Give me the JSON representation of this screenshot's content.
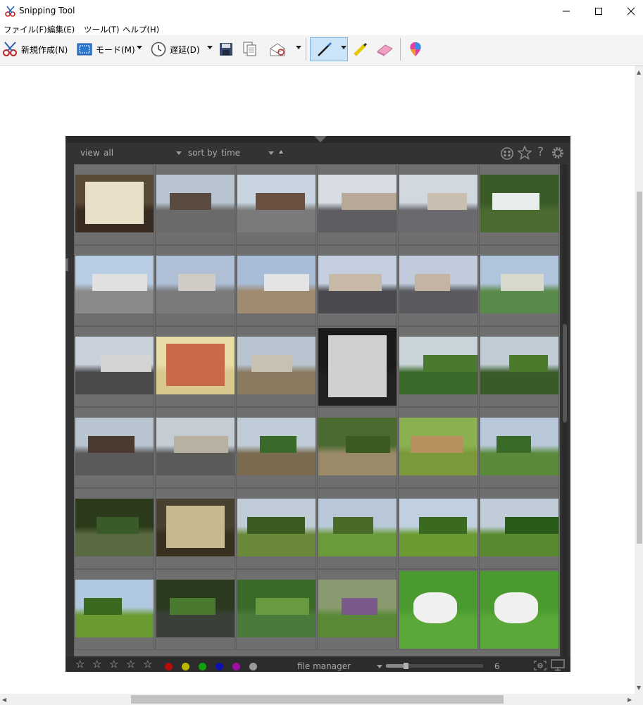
{
  "window": {
    "title": "Snipping Tool"
  },
  "menu": [
    "ファイル(F)",
    "編集(E)",
    "ツール(T)",
    "ヘルプ(H)"
  ],
  "toolbar": {
    "new_label": "新規作成(N)",
    "mode_label": "モード(M)",
    "delay_label": "遅延(D)"
  },
  "darktable": {
    "view_label": "view",
    "view_value": "all",
    "sort_label": "sort by",
    "sort_value": "time",
    "module_label": "file manager",
    "zoom_value": "6"
  },
  "color_labels": [
    "#b80c0c",
    "#bbb800",
    "#10a010",
    "#1010b0",
    "#a010a0",
    "#9a9a9a"
  ],
  "icons": [
    "scissors-icon",
    "pen-icon",
    "highlighter-icon",
    "eraser-icon",
    "paint3d-icon",
    "clock-icon",
    "save-icon",
    "copy-icon",
    "email-icon",
    "grouping-icon",
    "star-icon",
    "help-icon",
    "gear-icon"
  ],
  "thumbnails": [
    {
      "sky": "#5a4a38",
      "ground": "#3a2c20",
      "obj": "#e8e0c8"
    },
    {
      "sky": "#b8c4d0",
      "ground": "#6a6a6a",
      "obj": "#5a4a40"
    },
    {
      "sky": "#c8d4e0",
      "ground": "#7a7a7a",
      "obj": "#6a5040"
    },
    {
      "sky": "#d8dde4",
      "ground": "#5e5e62",
      "obj": "#b8a898"
    },
    {
      "sky": "#d2d8e0",
      "ground": "#6a6a6e",
      "obj": "#c8bfb0"
    },
    {
      "sky": "#3a5a28",
      "ground": "#4a6a30",
      "obj": "#e8ecec"
    },
    {
      "sky": "#b8cce4",
      "ground": "#8a8a8a",
      "obj": "#e0e0e0"
    },
    {
      "sky": "#aebfd6",
      "ground": "#7a7a7c",
      "obj": "#d0ccc4"
    },
    {
      "sky": "#a8bcd8",
      "ground": "#a08a70",
      "obj": "#e4e4e4"
    },
    {
      "sky": "#c4d0e0",
      "ground": "#4a4a4e",
      "obj": "#c8b8a8"
    },
    {
      "sky": "#c0ccdc",
      "ground": "#5a5a5e",
      "obj": "#c4b4a4"
    },
    {
      "sky": "#b0c4dc",
      "ground": "#5a8a4a",
      "obj": "#d8d8cc"
    },
    {
      "sky": "#c8d0dc",
      "ground": "#4a4a4c",
      "obj": "#d4d4d4"
    },
    {
      "sky": "#e8dca8",
      "ground": "#d8c890",
      "obj": "#c86a4a"
    },
    {
      "sky": "#b8c4d0",
      "ground": "#8a7a60",
      "obj": "#c8c0b0"
    },
    {
      "sky": "#1a1a1a",
      "ground": "#222222",
      "obj": "#d0d0d0"
    },
    {
      "sky": "#c8d4d8",
      "ground": "#3a6a2a",
      "obj": "#4a7a30"
    },
    {
      "sky": "#c0ccd4",
      "ground": "#3a5a2a",
      "obj": "#4a7a2a"
    },
    {
      "sky": "#b8c4d0",
      "ground": "#5a5a5a",
      "obj": "#4a3a30"
    },
    {
      "sky": "#c4ccd4",
      "ground": "#5a5a58",
      "obj": "#b8b0a0"
    },
    {
      "sky": "#c0ccd8",
      "ground": "#7a6a50",
      "obj": "#3a6a2a"
    },
    {
      "sky": "#4a6a30",
      "ground": "#9a8a6a",
      "obj": "#3a5a20"
    },
    {
      "sky": "#8ab050",
      "ground": "#7a9a3a",
      "obj": "#b89060"
    },
    {
      "sky": "#b8c8d8",
      "ground": "#5a8a3a",
      "obj": "#3a6a28"
    },
    {
      "sky": "#2a3a1a",
      "ground": "#5a6a40",
      "obj": "#3a5a28"
    },
    {
      "sky": "#4a4030",
      "ground": "#3a3020",
      "obj": "#c8b890"
    },
    {
      "sky": "#c0ccd8",
      "ground": "#6a8a3a",
      "obj": "#3a5a20"
    },
    {
      "sky": "#b8c8d8",
      "ground": "#6a9a3a",
      "obj": "#4a6a28"
    },
    {
      "sky": "#c0d0e0",
      "ground": "#6a9a30",
      "obj": "#3a6a20"
    },
    {
      "sky": "#c0ccd8",
      "ground": "#5a8a30",
      "obj": "#2a5a18"
    },
    {
      "sky": "#b0c8e0",
      "ground": "#6a9a30",
      "obj": "#3a6a20"
    },
    {
      "sky": "#2a3a20",
      "ground": "#3a4038",
      "obj": "#4a7a30"
    },
    {
      "sky": "#3a6a28",
      "ground": "#4a7a3a",
      "obj": "#6a9a40"
    },
    {
      "sky": "#8a9a70",
      "ground": "#5a8a38",
      "obj": "#7a5a8a"
    },
    {
      "sky": "#4a9a30",
      "ground": "#5aa838",
      "obj": "#f0f0f0"
    },
    {
      "sky": "#4a9a30",
      "ground": "#5aa838",
      "obj": "#f0f0f0"
    }
  ]
}
